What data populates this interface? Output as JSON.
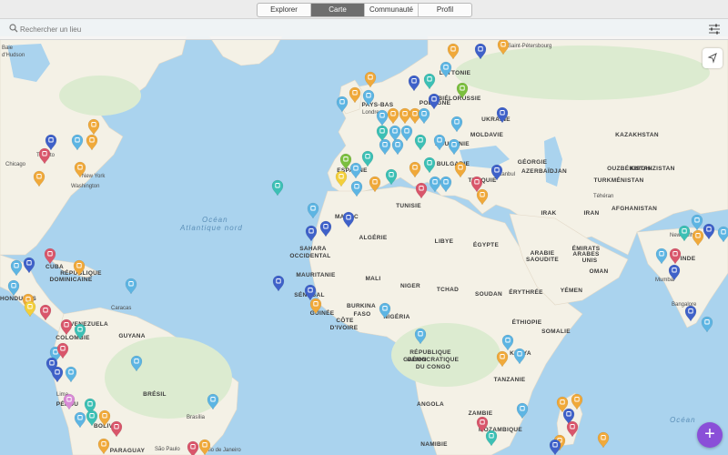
{
  "tabs": [
    {
      "label": "Explorer",
      "active": false
    },
    {
      "label": "Carte",
      "active": true
    },
    {
      "label": "Communauté",
      "active": false
    },
    {
      "label": "Profil",
      "active": false
    }
  ],
  "search": {
    "placeholder": "Rechercher un lieu"
  },
  "icons": {
    "search": "search-icon",
    "filter": "filter-sliders-icon",
    "locate": "location-arrow-icon",
    "add": "plus-icon"
  },
  "add_button": {
    "label": "+"
  },
  "colors": {
    "accent": "#8a4fd8",
    "water": "#aad3ee",
    "land": "#f4f1e6",
    "pin_orange": "#f0a93a",
    "pin_teal": "#3cc0b5",
    "pin_blue": "#3f61c9",
    "pin_sky": "#5db5e3",
    "pin_red": "#d9566b",
    "pin_green": "#7bbf3e",
    "pin_yellow": "#f3cf3a",
    "pin_pink": "#d98ad6"
  },
  "map_labels": {
    "oceans": [
      "Océan",
      "Atlantique nord",
      "Océan"
    ],
    "countries": [
      "LETTONIE",
      "BIÉLORUSSIE",
      "POLOGNE",
      "UKRAINE",
      "MOLDAVIE",
      "ROUMANIE",
      "BULGARIE",
      "KAZAKHSTAN",
      "OUZBÉKISTAN",
      "KIRGHIZISTAN",
      "TURKMÉNISTAN",
      "AZERBAÏDJAN",
      "GÉORGIE",
      "IRAK",
      "IRAN",
      "AFGHANISTAN",
      "PAYS-BAS",
      "ESPAGNE",
      "MAROC",
      "ALGÉRIE",
      "LIBYE",
      "ÉGYPTE",
      "TUNISIE",
      "SAHARA",
      "OCCIDENTAL",
      "MAURITANIE",
      "MALI",
      "NIGER",
      "TCHAD",
      "SOUDAN",
      "ÉRYTHRÉE",
      "BURKINA",
      "FASO",
      "NIGÉRIA",
      "GUINÉE",
      "CÔTE",
      "D'IVOIRE",
      "ÉTHIOPIE",
      "SOMALIE",
      "KENYA",
      "TANZANIE",
      "GABON",
      "RÉPUBLIQUE",
      "DÉMOCRATIQUE",
      "DU CONGO",
      "ANGOLA",
      "ZAMBIE",
      "MOZAMBIQUE",
      "NAMIBIE",
      "ARABIE",
      "SAOUDITE",
      "ÉMIRATS",
      "ARABES",
      "UNIS",
      "OMAN",
      "YÉMEN",
      "INDE",
      "TURQUIE",
      "CUBA",
      "RÉPUBLIQUE",
      "DOMINICAINE",
      "VENEZUELA",
      "GUYANA",
      "COLOMBIE",
      "BRÉSIL",
      "BOLIVIE",
      "PARAGUAY",
      "HONDURAS",
      "SÉNÉGAL",
      "PÉROU"
    ],
    "cities": [
      "Baie",
      "d'Hudson",
      "Chicago",
      "Toronto",
      "New York",
      "Washington",
      "Saint-Pétersbourg",
      "Londres",
      "Istanbul",
      "Téhéran",
      "New Delhi",
      "Mumbai",
      "Bangalore",
      "Caracas",
      "Lima",
      "Brasília",
      "São Paulo",
      "Rio de Janeiro"
    ]
  }
}
